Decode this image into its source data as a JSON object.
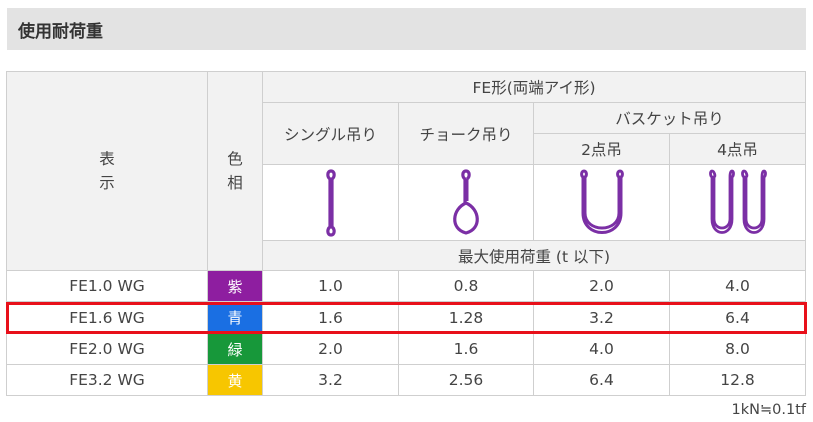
{
  "title": "使用耐荷重",
  "header": {
    "display_line1": "表",
    "display_line2": "示",
    "color_line1": "色",
    "color_line2": "相",
    "group": "FE形(両端アイ形)",
    "single": "シングル吊り",
    "choke": "チョーク吊り",
    "basket": "バスケット吊り",
    "two_point": "2点吊",
    "four_point": "4点吊",
    "max_load": "最大使用荷重 (t 以下)"
  },
  "icons": {
    "single": "sling-single-icon",
    "choke": "sling-choke-icon",
    "basket_2": "sling-basket-2point-icon",
    "basket_4": "sling-basket-4point-icon",
    "sling_color": "#7b2fa5"
  },
  "rows": [
    {
      "name": "FE1.0 WG",
      "color": "紫",
      "color_hex": "#8e1ea0",
      "single": "1.0",
      "choke": "0.8",
      "basket2": "2.0",
      "basket4": "4.0"
    },
    {
      "name": "FE1.6 WG",
      "color": "青",
      "color_hex": "#1a6fe3",
      "single": "1.6",
      "choke": "1.28",
      "basket2": "3.2",
      "basket4": "6.4"
    },
    {
      "name": "FE2.0 WG",
      "color": "緑",
      "color_hex": "#17983a",
      "single": "2.0",
      "choke": "1.6",
      "basket2": "4.0",
      "basket4": "8.0"
    },
    {
      "name": "FE3.2 WG",
      "color": "黄",
      "color_hex": "#f7c600",
      "single": "3.2",
      "choke": "2.56",
      "basket2": "6.4",
      "basket4": "12.8"
    }
  ],
  "highlight_color": "#e8101a",
  "footnote": "1kN≒0.1tf"
}
